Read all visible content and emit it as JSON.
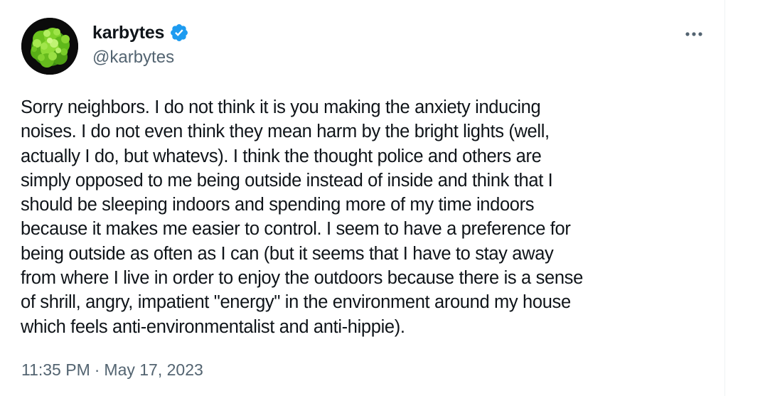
{
  "tweet": {
    "author": {
      "display_name": "karbytes",
      "handle": "@karbytes",
      "verified": true,
      "verified_color": "#1d9bf0",
      "avatar_icon": "green-broccoli-avatar"
    },
    "more_icon": "more-horizontal-icon",
    "text": "Sorry neighbors. I do not think it is you making the anxiety inducing\nnoises. I do not even think they mean harm by the bright lights (well,\nactually I do, but whatevs). I think the thought police and others are\nsimply opposed to me being outside instead of inside and think that I\nshould be sleeping indoors and spending more of my time indoors\nbecause it makes me easier to control. I seem to have a preference for\nbeing outside as often as I can (but it seems that I have to stay away\nfrom where I live in order to enjoy the outdoors because there is a sense\nof shrill, angry, impatient \"energy\" in the environment around my house\nwhich feels anti-environmentalist and anti-hippie).",
    "time": "11:35 PM",
    "separator": "·",
    "date": "May 17, 2023"
  },
  "colors": {
    "text_primary": "#0f1419",
    "text_secondary": "#536471",
    "border": "#eff3f4"
  }
}
